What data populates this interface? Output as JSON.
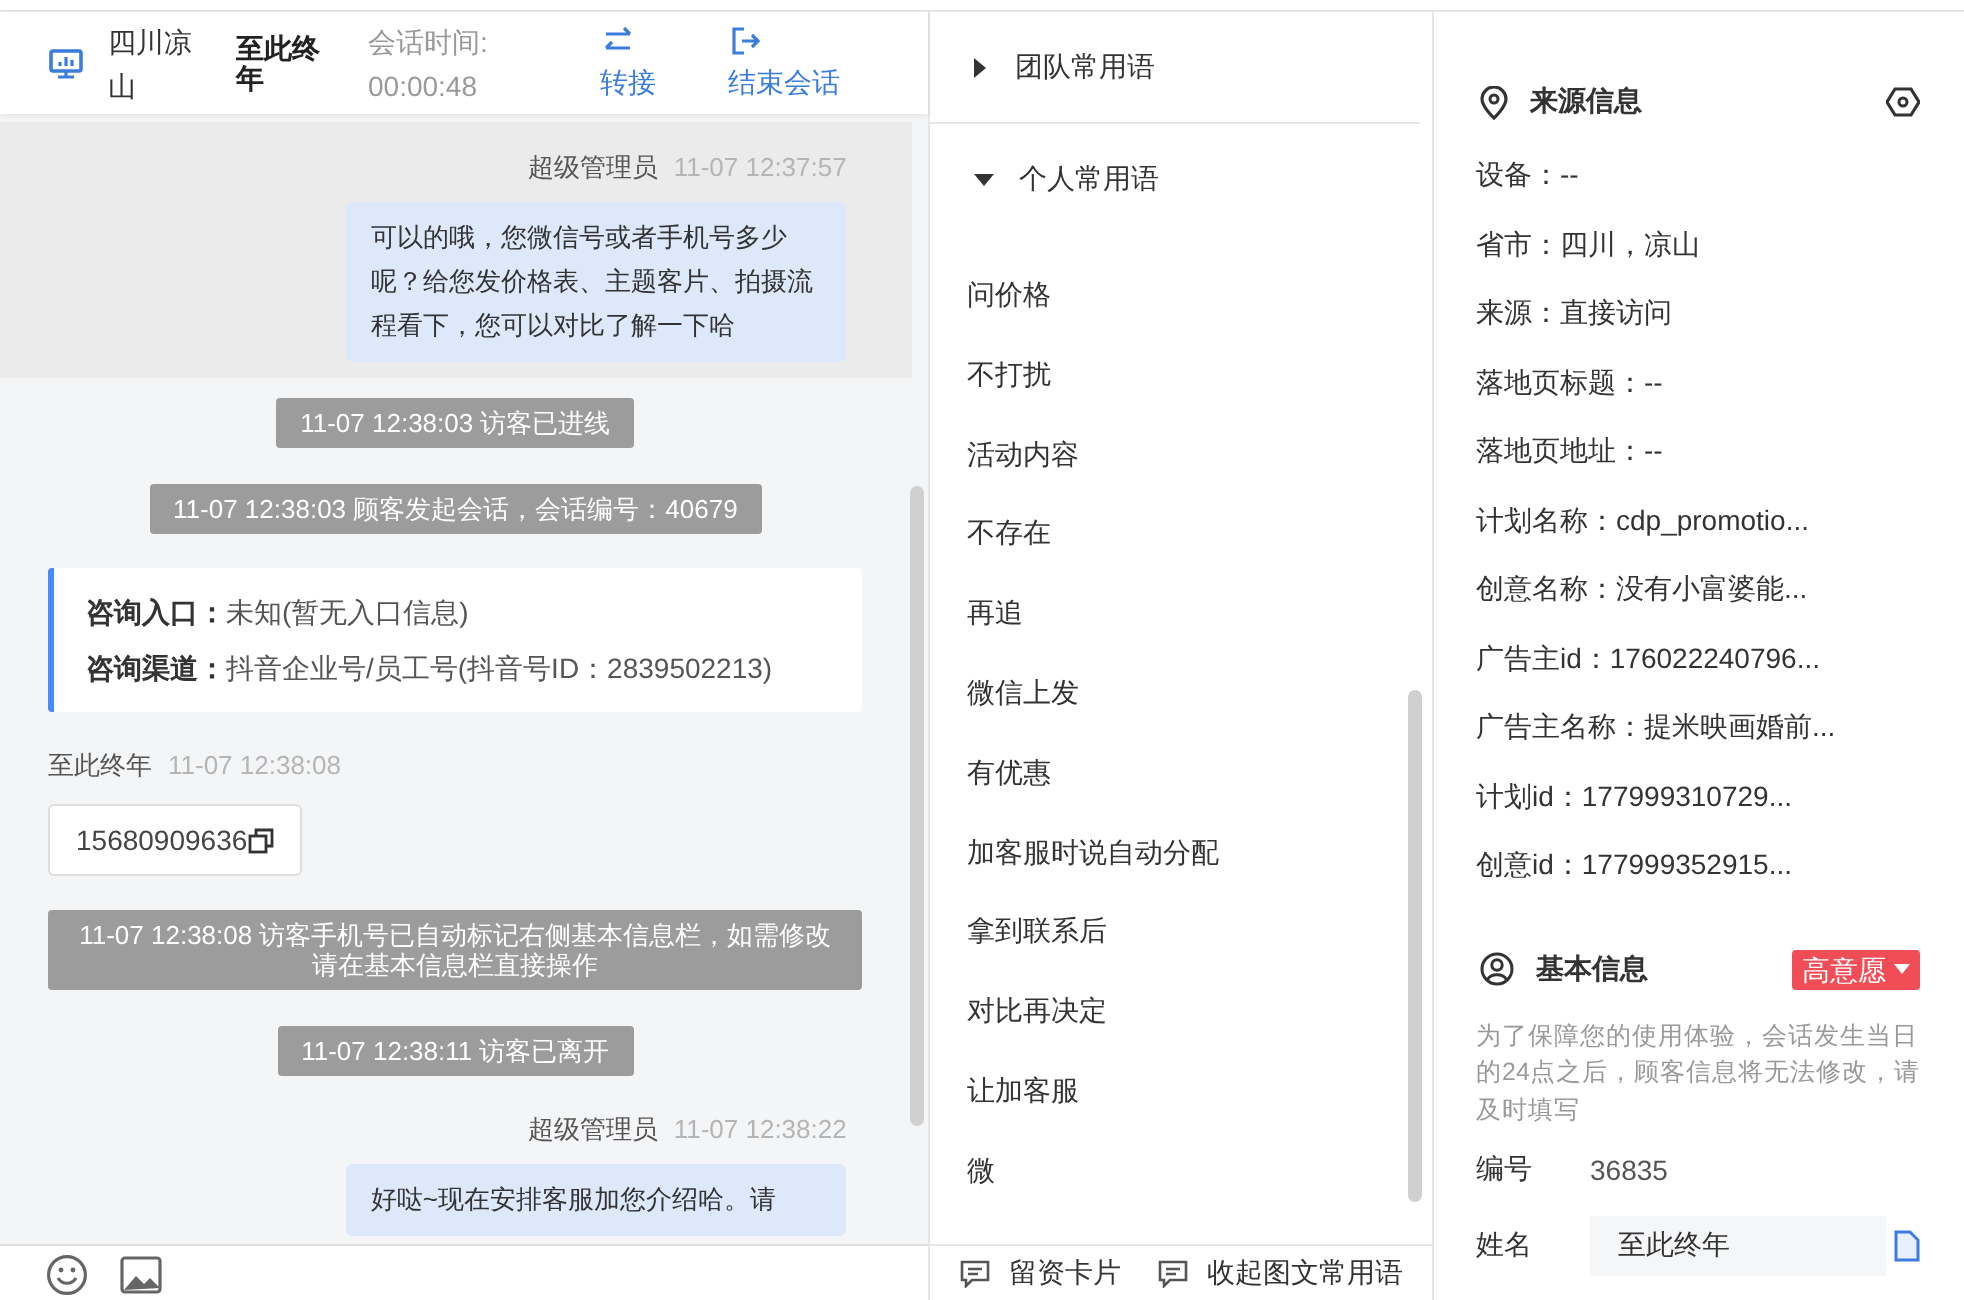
{
  "header": {
    "location": "四川凉山",
    "visitor": "至此终年",
    "session_label": "会话时间:",
    "session_time": "00:00:48",
    "actions": [
      {
        "kind": "transfer",
        "label": "转接"
      },
      {
        "kind": "end",
        "label": "结束会话"
      }
    ]
  },
  "messages": [
    {
      "kind": "agent",
      "selected": true,
      "sender": "超级管理员",
      "time": "11-07 12:37:57",
      "text": "可以的哦，您微信号或者手机号多少呢？给您发价格表、主题客片、拍摄流程看下，您可以对比了解一下哈"
    },
    {
      "kind": "system",
      "text": "11-07 12:38:03 访客已进线"
    },
    {
      "kind": "system",
      "text": "11-07 12:38:03 顾客发起会话，会话编号：40679"
    },
    {
      "kind": "entry",
      "rows": [
        {
          "label": "咨询入口：",
          "value": "未知(暂无入口信息)"
        },
        {
          "label": "咨询渠道：",
          "value": "抖音企业号/员工号(抖音号ID：2839502213)"
        }
      ]
    },
    {
      "kind": "visitor_phone",
      "sender": "至此终年",
      "time": "11-07 12:38:08",
      "text": "15680909636"
    },
    {
      "kind": "system",
      "text": "11-07 12:38:08 访客手机号已自动标记右侧基本信息栏，如需修改请在基本信息栏直接操作"
    },
    {
      "kind": "system",
      "text": "11-07 12:38:11 访客已离开"
    },
    {
      "kind": "agent",
      "selected": false,
      "sender": "超级管理员",
      "time": "11-07 12:38:22",
      "text": "好哒~现在安排客服加您介绍哈。请"
    }
  ],
  "phrases": {
    "groups": [
      {
        "title": "团队常用语",
        "expanded": false
      },
      {
        "title": "个人常用语",
        "expanded": true,
        "items": [
          "问价格",
          "不打扰",
          "活动内容",
          "不存在",
          "再追",
          "微信上发",
          "有优惠",
          "加客服时说自动分配",
          "拿到联系后",
          "对比再决定",
          "让加客服",
          "微"
        ]
      }
    ],
    "footer_actions": [
      "留资卡片",
      "收起图文常用语"
    ]
  },
  "source_info": {
    "title": "来源信息",
    "fields": [
      "设备：--",
      "省市：四川，凉山",
      "来源：直接访问",
      "落地页标题：--",
      "落地页地址：--",
      "计划名称：cdp_promotio...",
      "创意名称：没有小富婆能...",
      "广告主id：176022240796...",
      "广告主名称：提米映画婚前...",
      "计划id：177999310729...",
      "创意id：177999352915..."
    ]
  },
  "basic_info": {
    "title": "基本信息",
    "intent": {
      "label": "高意愿",
      "color": "#f04d57"
    },
    "note": "为了保障您的使用体验，会话发生当日的24点之后，顾客信息将无法修改，请及时填写",
    "fields": [
      {
        "kind": "text",
        "label": "编号",
        "value": "36835"
      },
      {
        "kind": "input",
        "label": "姓名",
        "value": "至此终年"
      }
    ]
  }
}
